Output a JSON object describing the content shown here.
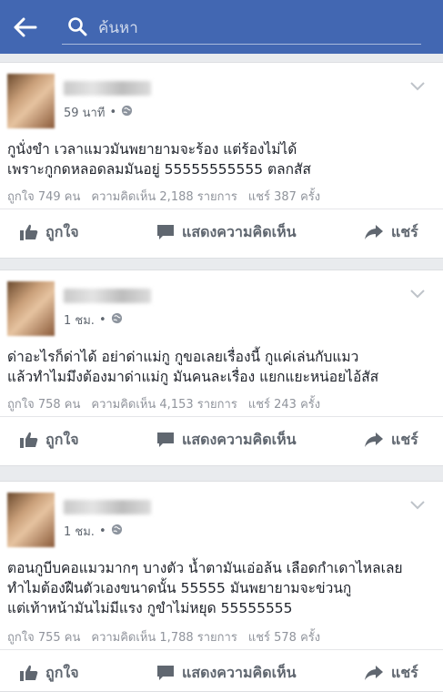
{
  "search": {
    "placeholder": "ค้นหา"
  },
  "posts": [
    {
      "time": "59 นาที",
      "text": "กูนั่งขำ เวลาแมวมันพยายามจะร้อง แต่ร้องไม่ได้\nเพราะกูกดหลอดลมมันอยู่ 55555555555 ตลกสัส",
      "likes": "ถูกใจ 749 คน",
      "comments": "ความคิดเห็น 2,188 รายการ",
      "shares": "แชร์ 387 ครั้ง"
    },
    {
      "time": "1 ชม.",
      "text": "ด่าอะไรก็ด่าได้ อย่าด่าแม่กู กูขอเลยเรื่องนี้ กูแค่เล่นกับแมว\nแล้วทำไมมึงต้องมาด่าแม่กู มันคนละเรื่อง แยกแยะหน่อยไอ้สัส",
      "likes": "ถูกใจ 758 คน",
      "comments": "ความคิดเห็น 4,153 รายการ",
      "shares": "แชร์ 243 ครั้ง"
    },
    {
      "time": "1 ชม.",
      "text": "ตอนกูบีบคอแมวมากๆ บางตัว น้ำตามันเอ่อล้น เลือดกำเดาไหลเลย\nทำไมต้องฝืนตัวเองขนาดนั้น 55555 มันพยายามจะข่วนกู\nแต่เท้าหน้ามันไม่มีแรง กูขำไม่หยุด 55555555",
      "likes": "ถูกใจ 755 คน",
      "comments": "ความคิดเห็น 1,788 รายการ",
      "shares": "แชร์ 578 ครั้ง"
    }
  ],
  "actions": {
    "like": "ถูกใจ",
    "comment": "แสดงความคิดเห็น",
    "share": "แชร์"
  },
  "colors": {
    "brand": "#4267b2",
    "muted": "#606770",
    "stats": "#90949c"
  }
}
